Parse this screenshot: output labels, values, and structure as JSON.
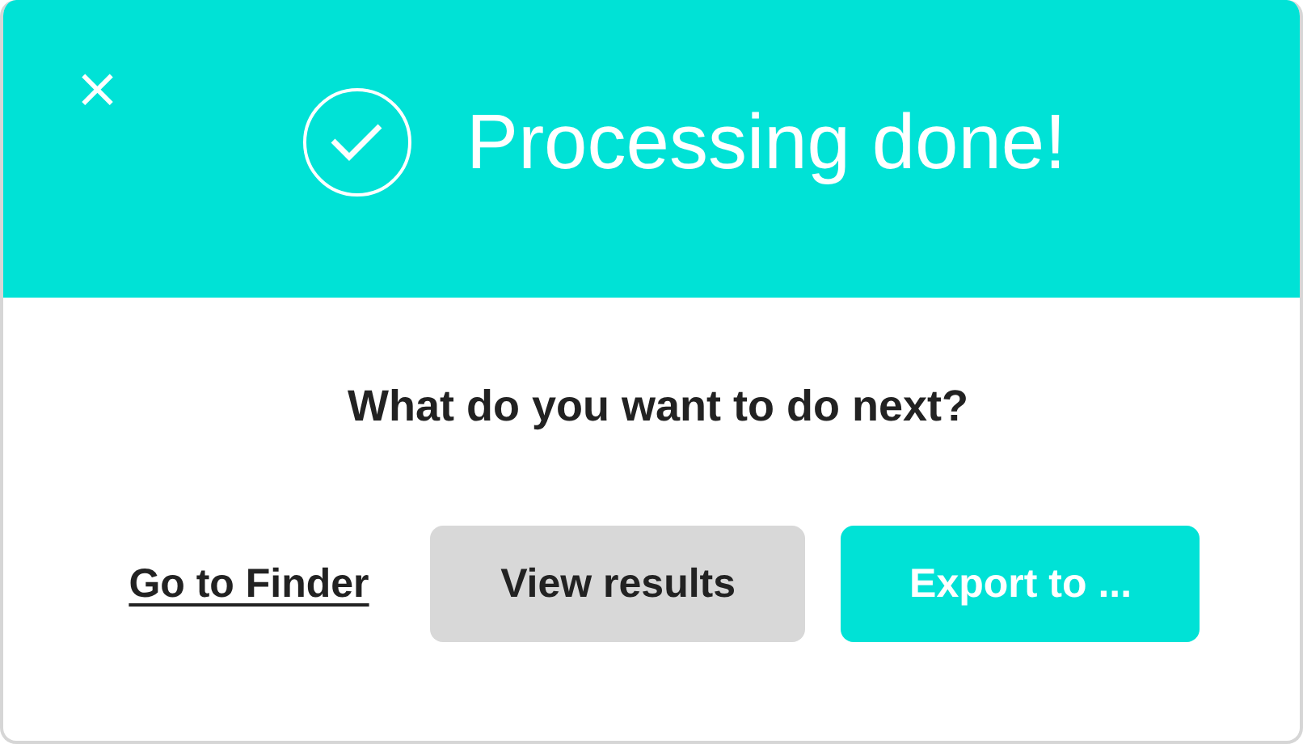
{
  "close_button": "×",
  "title": "Processing done!",
  "question": "What do you want to do next?",
  "actions": [
    {
      "kind": "link",
      "label": "Go to Finder"
    },
    {
      "kind": "secondary",
      "label": "View results"
    },
    {
      "kind": "primary",
      "label": "Export to ..."
    }
  ]
}
